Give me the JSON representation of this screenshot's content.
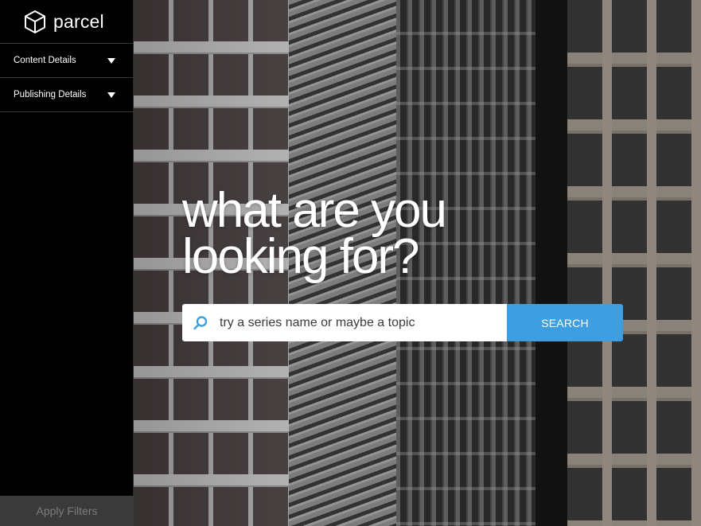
{
  "brand": {
    "name": "parcel",
    "logo_icon": "cube-icon"
  },
  "sidebar": {
    "filters": [
      {
        "label": "Content Details",
        "icon": "caret-down-icon"
      },
      {
        "label": "Publishing Details",
        "icon": "caret-down-icon"
      }
    ],
    "apply_label": "Apply Filters"
  },
  "hero": {
    "headline_line1": "what are you",
    "headline_line2": "looking for?"
  },
  "search": {
    "placeholder": "try a series name or maybe a topic",
    "value": "",
    "button_label": "SEARCH",
    "icon": "search-icon"
  },
  "colors": {
    "accent": "#3f9ee0",
    "sidebar_bg": "#000000",
    "apply_bg": "#3a3a3a",
    "apply_text": "#7c7c7c"
  }
}
